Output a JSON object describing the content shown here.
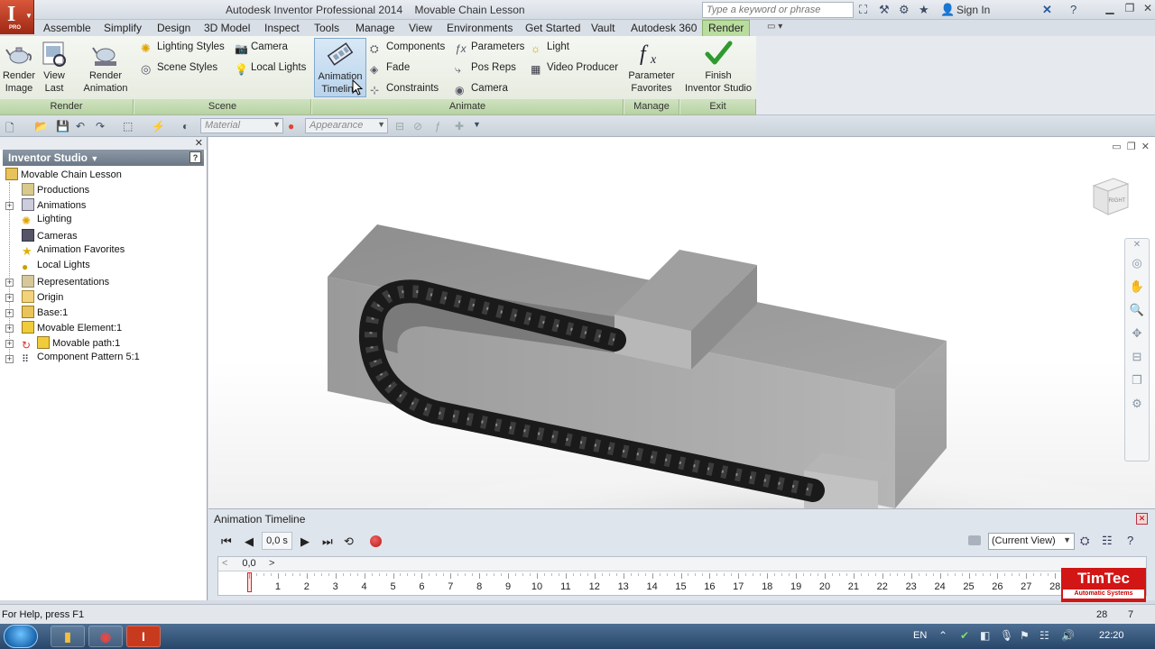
{
  "app": {
    "title": "Autodesk Inventor Professional 2014",
    "document": "Movable Chain Lesson",
    "app_button_letter": "I",
    "app_button_sub": "PRO",
    "search_placeholder": "Type a keyword or phrase",
    "sign_in": "Sign In"
  },
  "menu_tabs": [
    "Assemble",
    "Simplify",
    "Design",
    "3D Model",
    "Inspect",
    "Tools",
    "Manage",
    "View",
    "Environments",
    "Get Started",
    "Vault",
    "Autodesk 360",
    "Render"
  ],
  "active_tab": "Render",
  "ribbon": {
    "render_panel": {
      "title": "Render",
      "render_image": "Render\nImage",
      "render_image_l1": "Render",
      "render_image_l2": "Image",
      "view_last_l1": "View",
      "view_last_l2": "Last",
      "render_animation_l1": "Render",
      "render_animation_l2": "Animation"
    },
    "scene_panel": {
      "title": "Scene",
      "lighting_styles": "Lighting Styles",
      "scene_styles": "Scene Styles",
      "camera": "Camera",
      "local_lights": "Local Lights"
    },
    "animate_panel": {
      "title": "Animate",
      "animation_timeline_l1": "Animation",
      "animation_timeline_l2": "Timeline",
      "components": "Components",
      "fade": "Fade",
      "constraints": "Constraints",
      "parameters": "Parameters",
      "pos_reps": "Pos Reps",
      "camera": "Camera",
      "light": "Light",
      "video_producer": "Video Producer"
    },
    "manage_panel": {
      "title": "Manage",
      "parameter_favorites_l1": "Parameter",
      "parameter_favorites_l2": "Favorites"
    },
    "exit_panel": {
      "title": "Exit",
      "finish_l1": "Finish",
      "finish_l2": "Inventor Studio"
    }
  },
  "qat": {
    "material_placeholder": "Material",
    "appearance_placeholder": "Appearance"
  },
  "browser": {
    "header": "Inventor Studio",
    "help": "?",
    "items": [
      {
        "label": "Movable Chain Lesson"
      },
      {
        "label": "Productions"
      },
      {
        "label": "Animations"
      },
      {
        "label": "Lighting"
      },
      {
        "label": "Cameras"
      },
      {
        "label": "Animation Favorites"
      },
      {
        "label": "Local Lights"
      },
      {
        "label": "Representations"
      },
      {
        "label": "Origin"
      },
      {
        "label": "Base:1"
      },
      {
        "label": "Movable Element:1"
      },
      {
        "label": "Movable path:1"
      },
      {
        "label": "Component Pattern 5:1"
      }
    ]
  },
  "viewcube_label": "RIGHT",
  "timeline": {
    "title": "Animation Timeline",
    "time_value": "0,0 s",
    "view_selection": "(Current View)",
    "position_value": "0,0",
    "prev": "<",
    "next": ">",
    "ticks": [
      "0",
      "1",
      "2",
      "3",
      "4",
      "5",
      "6",
      "7",
      "8",
      "9",
      "10",
      "11",
      "12",
      "13",
      "14",
      "15",
      "16",
      "17",
      "18",
      "19",
      "20",
      "21",
      "22",
      "23",
      "24",
      "25",
      "26",
      "27",
      "28"
    ]
  },
  "logo": {
    "name": "TimTec",
    "sub": "Automatic Systems"
  },
  "status": {
    "help": "For Help, press F1",
    "n1": "28",
    "n2": "7"
  },
  "taskbar": {
    "lang": "EN",
    "clock": "22:20"
  },
  "colors": {
    "accent_ribbon": "#b9dc9f",
    "logo_red": "#d21515",
    "record_red": "#c81e1e"
  }
}
